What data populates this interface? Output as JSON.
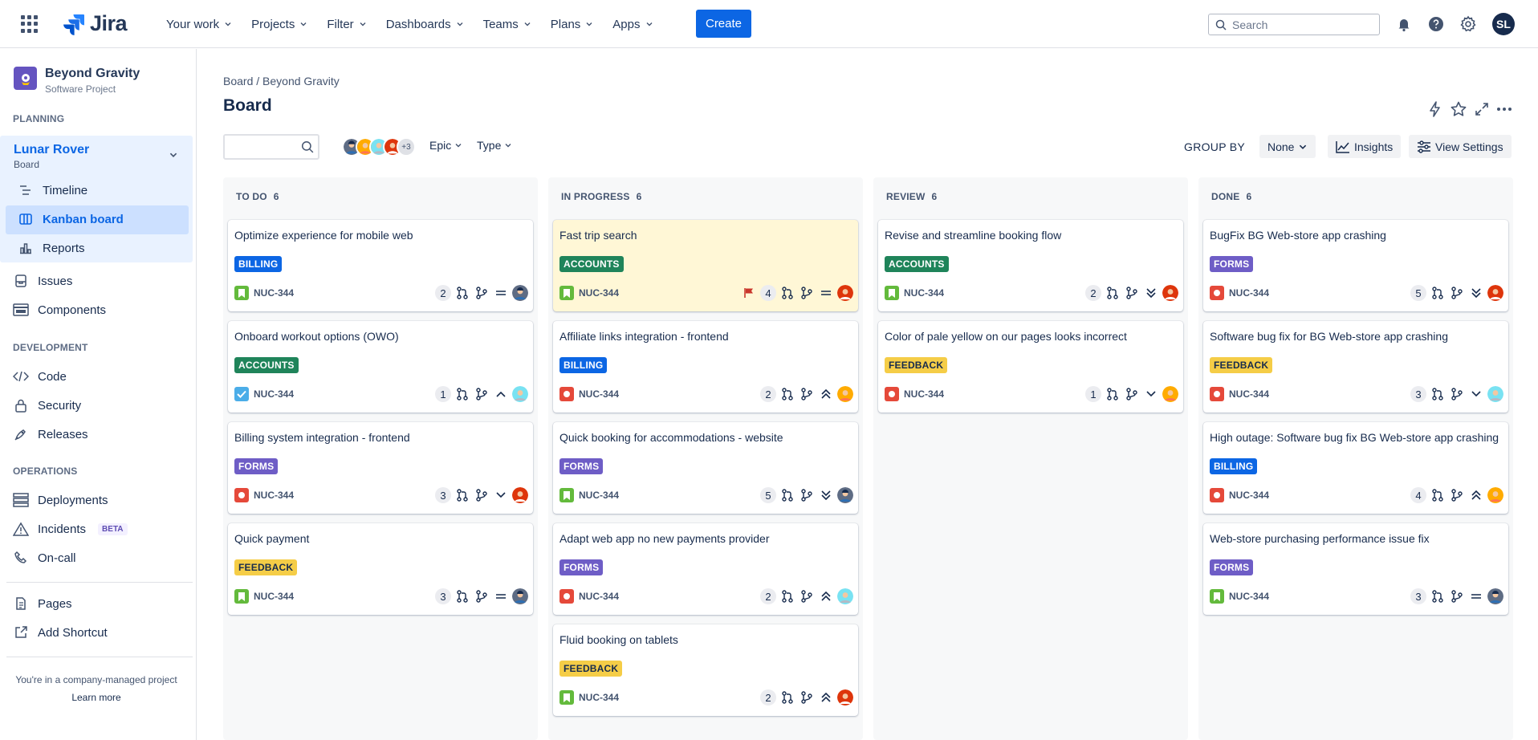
{
  "nav": {
    "logo": "Jira",
    "items": [
      "Your work",
      "Projects",
      "Filter",
      "Dashboards",
      "Teams",
      "Plans",
      "Apps"
    ],
    "create": "Create",
    "search_placeholder": "Search",
    "user_initials": "SL"
  },
  "sidebar": {
    "project_name": "Beyond Gravity",
    "project_type": "Software Project",
    "planning_label": "PLANNING",
    "board_name": "Lunar Rover",
    "board_sub": "Board",
    "planning_items": [
      "Timeline",
      "Kanban board",
      "Reports"
    ],
    "mid_items": [
      "Issues",
      "Components"
    ],
    "development_label": "DEVELOPMENT",
    "development_items": [
      "Code",
      "Security",
      "Releases"
    ],
    "operations_label": "OPERATIONS",
    "operations_items": [
      "Deployments",
      "Incidents",
      "On-call"
    ],
    "incidents_badge": "BETA",
    "other_items": [
      "Pages",
      "Add Shortcut"
    ],
    "footer_text": "You're in a company-managed project",
    "footer_link": "Learn more"
  },
  "main": {
    "breadcrumb": "Board / Beyond Gravity",
    "title": "Board",
    "avatars_more": "+3",
    "filter_epic": "Epic",
    "filter_type": "Type",
    "group_by_label": "GROUP BY",
    "group_by_value": "None",
    "insights": "Insights",
    "view_settings": "View Settings"
  },
  "colors": {
    "accent": "#0C66E4",
    "billing": "#0C66E4",
    "accounts": "#1F845A",
    "forms": "#6E5DC6",
    "feedback": "#F5CD47"
  },
  "columns": [
    {
      "name": "TO DO",
      "count": "6",
      "cards": [
        {
          "title": "Optimize experience for mobile web",
          "label": "BILLING",
          "type": "story",
          "key": "NUC-344",
          "count": "2",
          "priority": "medium",
          "avatar": "a1"
        },
        {
          "title": "Onboard workout options (OWO)",
          "label": "ACCOUNTS",
          "type": "task",
          "key": "NUC-344",
          "count": "1",
          "priority": "high",
          "avatar": "a2"
        },
        {
          "title": "Billing system integration - frontend",
          "label": "FORMS",
          "type": "bug",
          "key": "NUC-344",
          "count": "3",
          "priority": "low",
          "avatar": "a3"
        },
        {
          "title": "Quick payment",
          "label": "FEEDBACK",
          "type": "story",
          "key": "NUC-344",
          "count": "3",
          "priority": "medium",
          "avatar": "a1"
        }
      ]
    },
    {
      "name": "IN PROGRESS",
      "count": "6",
      "cards": [
        {
          "title": "Fast trip search",
          "label": "ACCOUNTS",
          "type": "story",
          "key": "NUC-344",
          "count": "4",
          "priority": "medium",
          "avatar": "a3",
          "flagged": true
        },
        {
          "title": "Affiliate links integration - frontend",
          "label": "BILLING",
          "type": "bug",
          "key": "NUC-344",
          "count": "2",
          "priority": "highest",
          "avatar": "a4"
        },
        {
          "title": "Quick booking for accommodations - website",
          "label": "FORMS",
          "type": "story",
          "key": "NUC-344",
          "count": "5",
          "priority": "lowest",
          "avatar": "a1"
        },
        {
          "title": "Adapt web app no new payments provider",
          "label": "FORMS",
          "type": "bug",
          "key": "NUC-344",
          "count": "2",
          "priority": "highest",
          "avatar": "a2"
        },
        {
          "title": "Fluid booking on tablets",
          "label": "FEEDBACK",
          "type": "story",
          "key": "NUC-344",
          "count": "2",
          "priority": "highest",
          "avatar": "a3"
        }
      ]
    },
    {
      "name": "REVIEW",
      "count": "6",
      "cards": [
        {
          "title": "Revise and streamline booking flow",
          "label": "ACCOUNTS",
          "type": "story",
          "key": "NUC-344",
          "count": "2",
          "priority": "lowest",
          "avatar": "a3"
        },
        {
          "title": "Color of pale yellow on our pages looks incorrect",
          "label": "FEEDBACK",
          "type": "bug",
          "key": "NUC-344",
          "count": "1",
          "priority": "low",
          "avatar": "a4"
        }
      ]
    },
    {
      "name": "DONE",
      "count": "6",
      "cards": [
        {
          "title": "BugFix BG Web-store app crashing",
          "label": "FORMS",
          "type": "bug",
          "key": "NUC-344",
          "count": "5",
          "priority": "lowest",
          "avatar": "a3"
        },
        {
          "title": "Software bug fix for BG Web-store app crashing",
          "label": "FEEDBACK",
          "type": "bug",
          "key": "NUC-344",
          "count": "3",
          "priority": "low",
          "avatar": "a2"
        },
        {
          "title": "High outage: Software bug fix BG Web-store app crashing",
          "label": "BILLING",
          "type": "bug",
          "key": "NUC-344",
          "count": "4",
          "priority": "highest",
          "avatar": "a4"
        },
        {
          "title": "Web-store purchasing performance issue fix",
          "label": "FORMS",
          "type": "story",
          "key": "NUC-344",
          "count": "3",
          "priority": "medium",
          "avatar": "a1"
        }
      ]
    }
  ]
}
